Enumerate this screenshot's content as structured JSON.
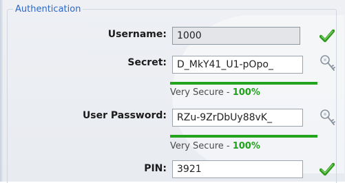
{
  "section": {
    "legend": "Authentication"
  },
  "username": {
    "label": "Username:",
    "value": "1000",
    "status_icon": "check-icon"
  },
  "secret": {
    "label": "Secret:",
    "value": "D_MkY41_U1-pOpo_",
    "action_icon": "key-icon",
    "strength_label": "Very Secure - ",
    "strength_value": "100%",
    "strength_fraction": 1.0
  },
  "user_password": {
    "label": "User Password:",
    "value": "RZu-9ZrDbUy88vK_",
    "action_icon": "key-icon",
    "strength_label": "Very Secure - ",
    "strength_value": "100%",
    "strength_fraction": 1.0
  },
  "pin": {
    "label": "PIN:",
    "value": "3921",
    "status_icon": "check-icon"
  },
  "colors": {
    "legend": "#2a67c8",
    "strength": "#22a51c",
    "check": "#2f9a1e"
  }
}
